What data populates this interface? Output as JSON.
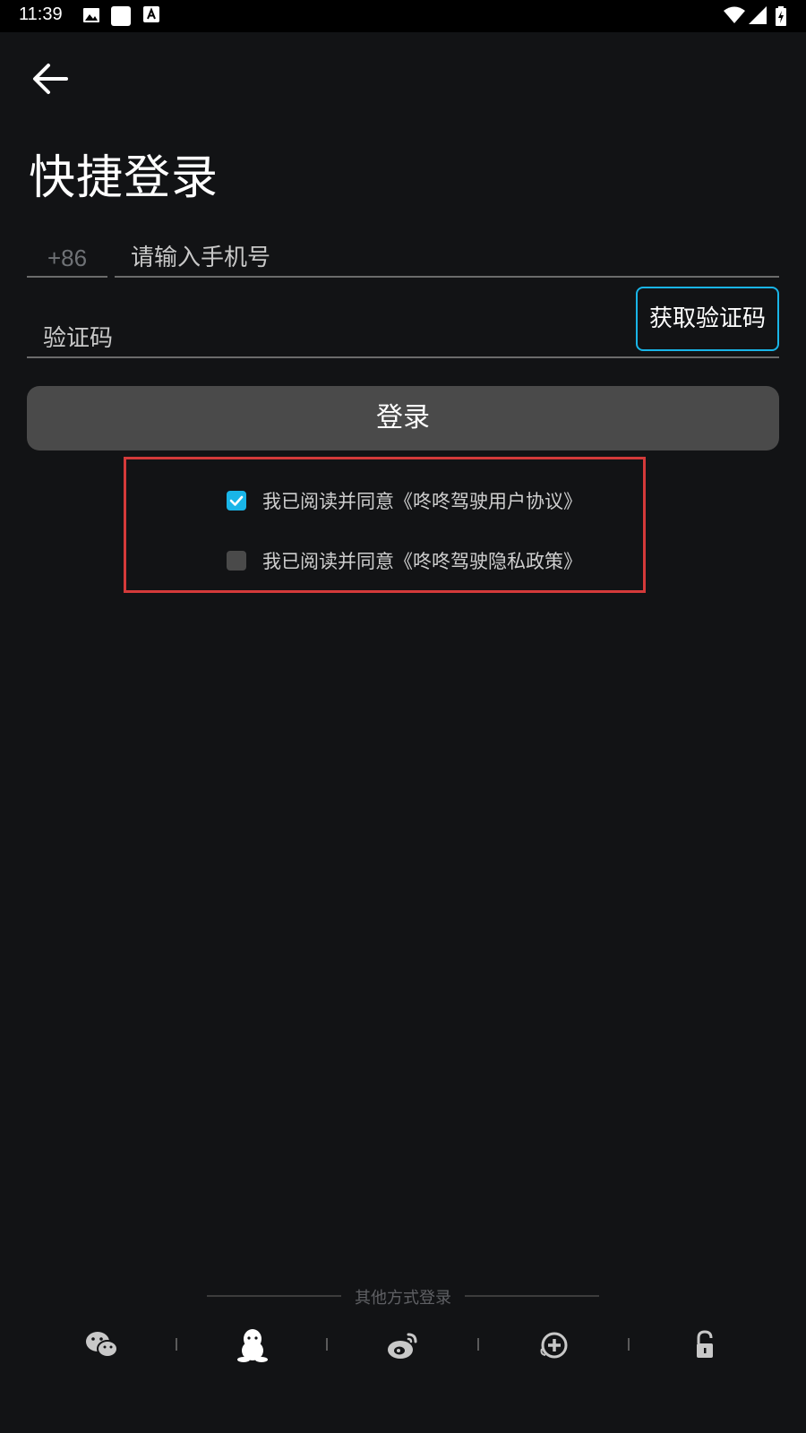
{
  "statusbar": {
    "time": "11:39",
    "icons": [
      "image-icon",
      "square-icon",
      "font-icon",
      "wifi-icon",
      "signal-icon",
      "battery-charging-icon"
    ]
  },
  "header": {
    "back_icon": "arrow-left-icon",
    "title": "快捷登录"
  },
  "form": {
    "country_code": "+86",
    "phone_placeholder": "请输入手机号",
    "code_placeholder": "验证码",
    "get_code_label": "获取验证码",
    "login_label": "登录"
  },
  "agreements": [
    {
      "text": "我已阅读并同意《咚咚驾驶用户协议》",
      "checked": true
    },
    {
      "text": "我已阅读并同意《咚咚驾驶隐私政策》",
      "checked": false
    }
  ],
  "other_login": {
    "label": "其他方式登录",
    "options": [
      "wechat-icon",
      "qq-icon",
      "weibo-icon",
      "plus-circle-icon",
      "lock-icon"
    ]
  },
  "colors": {
    "background": "#121315",
    "accent": "#19b5e8",
    "login_button": "#4a4a4a",
    "highlight_box": "#d43a3a"
  }
}
